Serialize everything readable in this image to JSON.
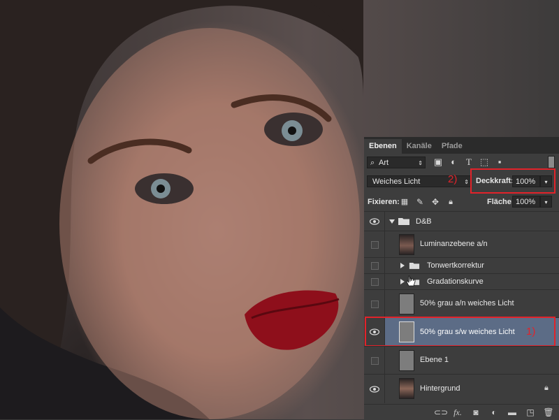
{
  "panel": {
    "tabs": [
      "Ebenen",
      "Kanäle",
      "Pfade"
    ],
    "filter_label": "Art",
    "blend_mode": "Weiches Licht",
    "opacity_label": "Deckkraft:",
    "opacity_value": "100%",
    "lock_label": "Fixieren:",
    "fill_label": "Fläche:",
    "fill_value": "100%"
  },
  "layers": [
    {
      "name": "D&B",
      "kind": "group",
      "visible": true,
      "expanded": true
    },
    {
      "name": "Luminanzebene a/n",
      "kind": "layer",
      "visible": false
    },
    {
      "name": "Tonwertkorrektur",
      "kind": "group",
      "visible": false
    },
    {
      "name": "Gradationskurve",
      "kind": "group",
      "visible": false
    },
    {
      "name": "50% grau a/n weiches Licht",
      "kind": "layer",
      "visible": false
    },
    {
      "name": "50% grau s/w weiches Licht",
      "kind": "layer",
      "visible": true,
      "selected": true
    },
    {
      "name": "Ebene 1",
      "kind": "layer",
      "visible": false
    },
    {
      "name": "Hintergrund",
      "kind": "layer",
      "visible": true,
      "locked": true
    }
  ],
  "annotations": {
    "label_1": "1)",
    "label_2": "2)",
    "color": "#e2232a"
  },
  "icons": [
    "search-icon",
    "image-filter-icon",
    "adjustment-filter-icon",
    "type-filter-icon",
    "shape-filter-icon",
    "smart-object-filter-icon",
    "link-icon",
    "fx-icon",
    "mask-icon",
    "adjustment-icon",
    "new-group-icon",
    "new-layer-icon",
    "trash-icon"
  ]
}
